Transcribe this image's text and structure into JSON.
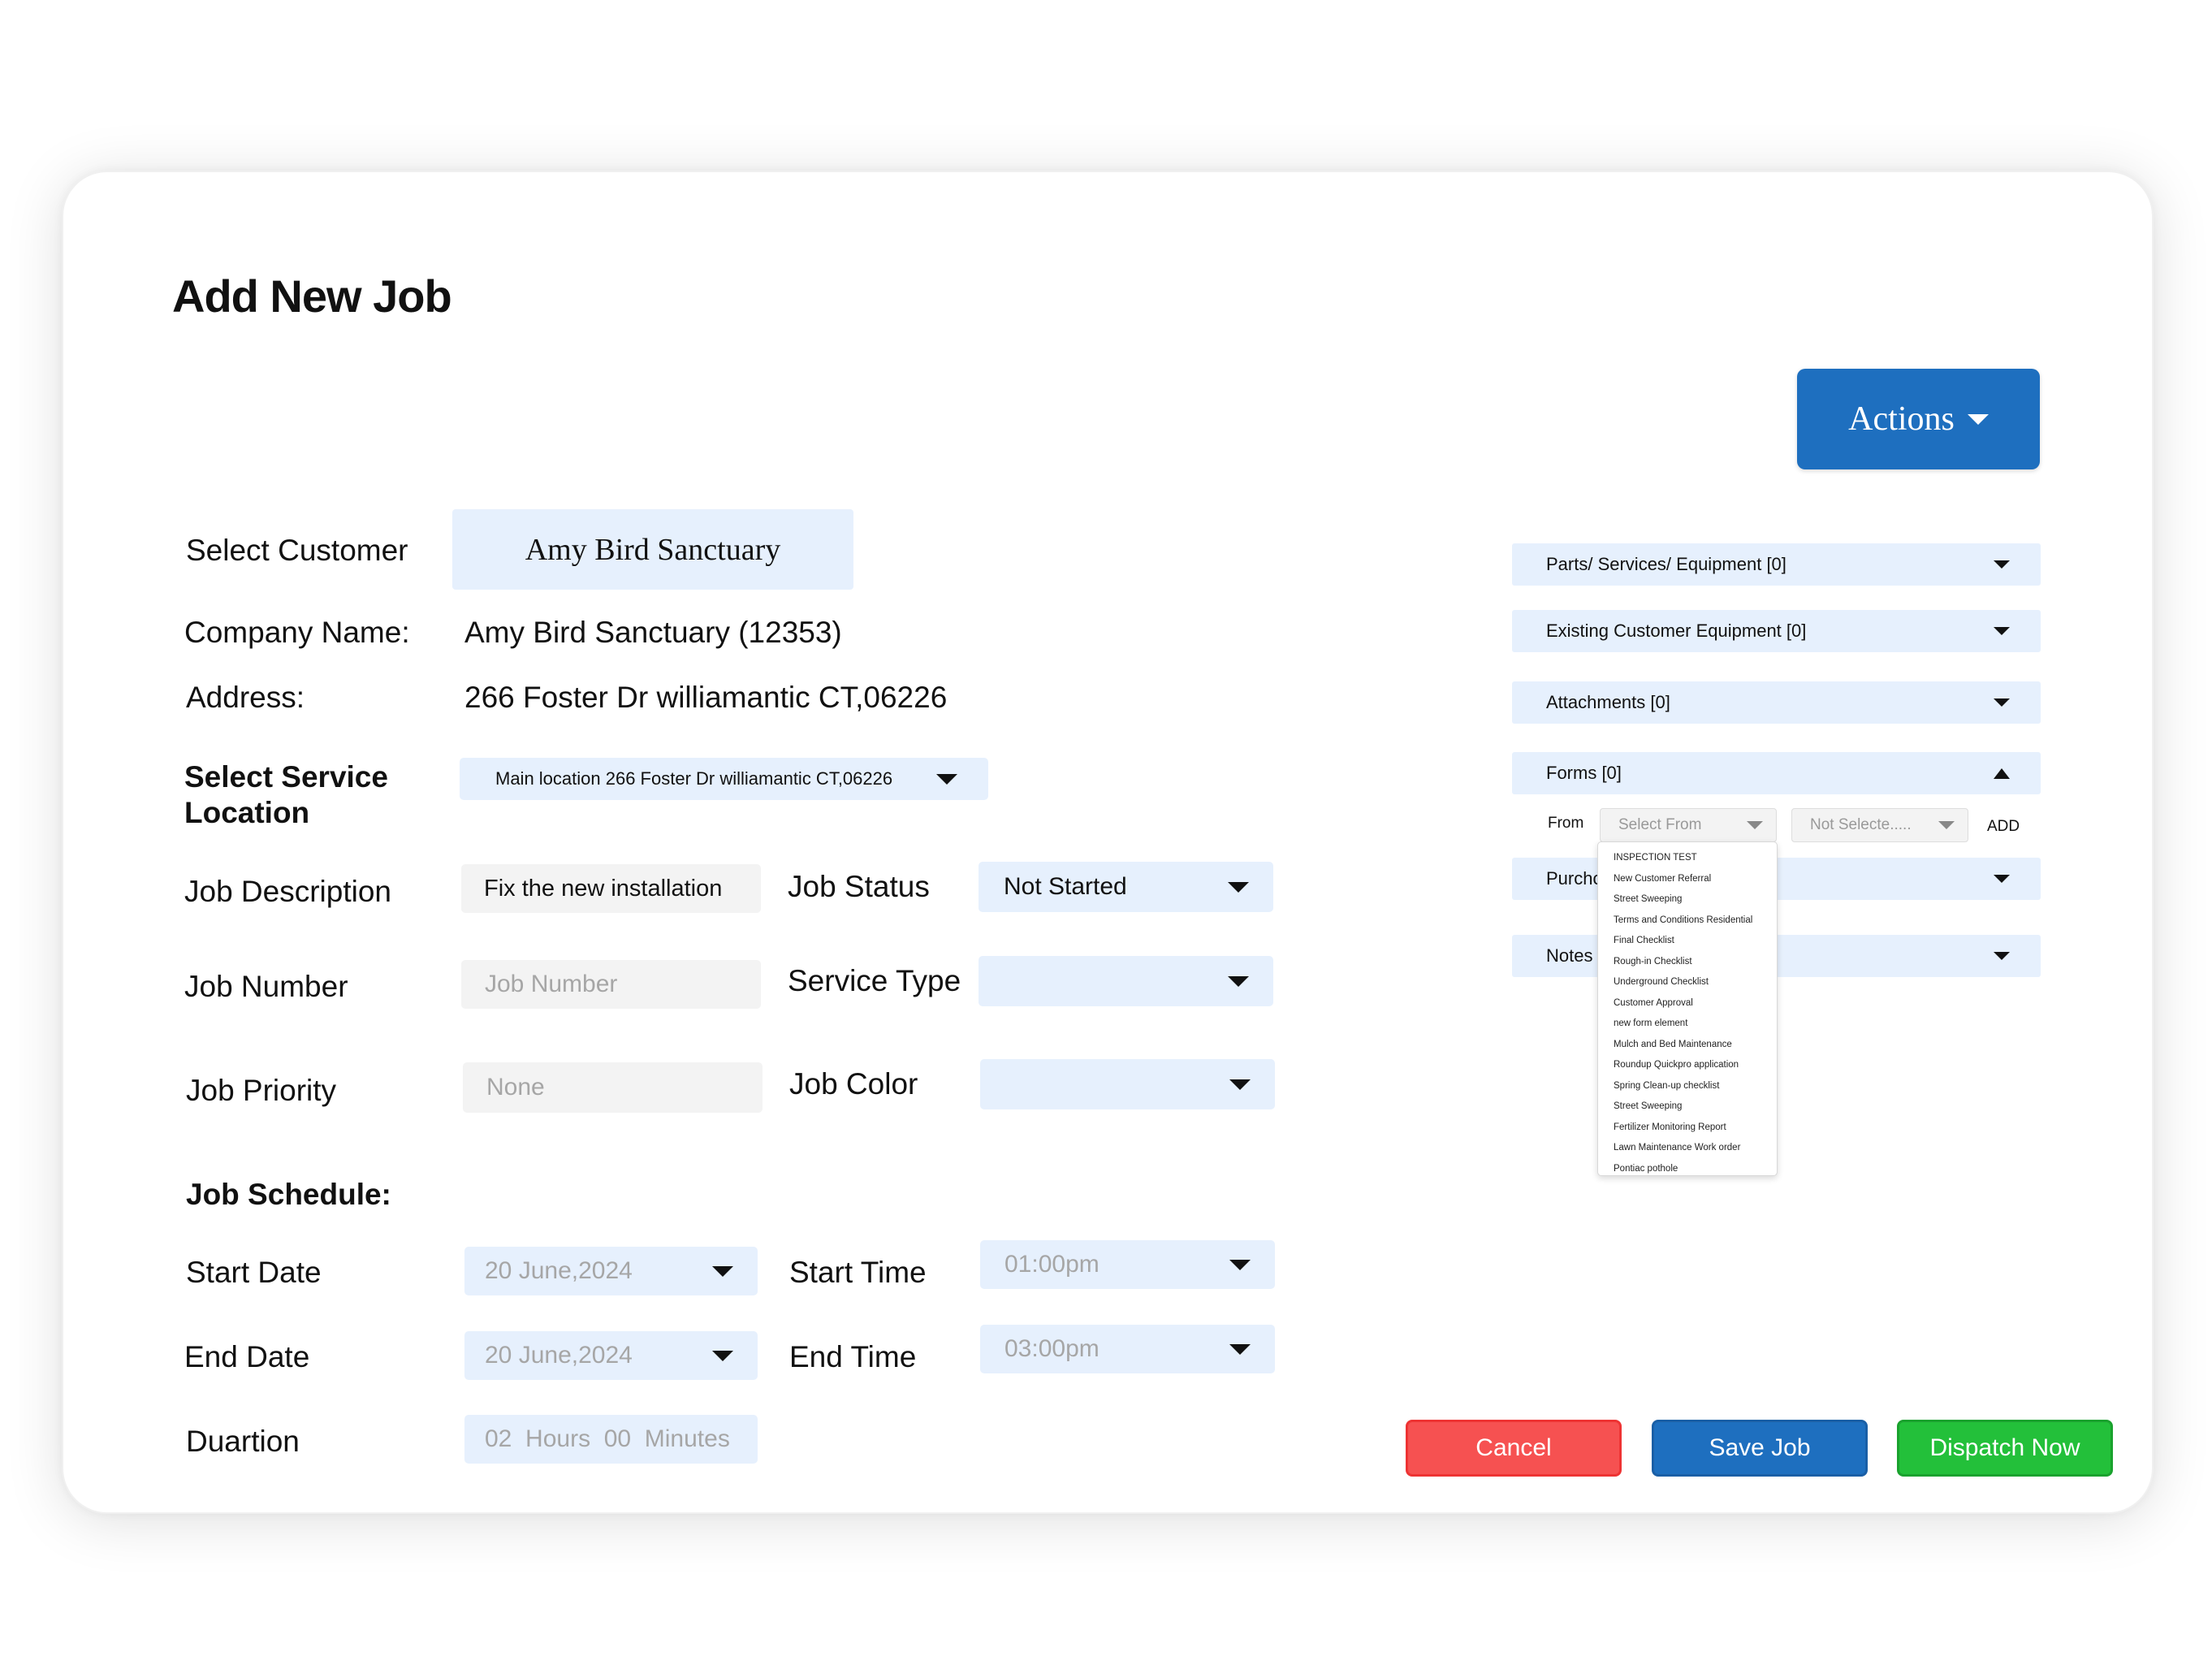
{
  "page_title": "Add New Job",
  "actions": {
    "label": "Actions"
  },
  "customer": {
    "select_label": "Select Customer",
    "selected": "Amy Bird Sanctuary",
    "company_label": "Company Name:",
    "company_value": "Amy Bird Sanctuary (12353)",
    "address_label": "Address:",
    "address_value": "266 Foster Dr williamantic CT,06226"
  },
  "service_location": {
    "label": "Select Service Location",
    "value": "Main location 266 Foster Dr williamantic CT,06226"
  },
  "job": {
    "description_label": "Job Description",
    "description_value": "Fix the new installation",
    "number_label": "Job Number",
    "number_placeholder": "Job Number",
    "priority_label": "Job Priority",
    "priority_value": "None",
    "status_label": "Job Status",
    "status_value": "Not Started",
    "service_type_label": "Service Type",
    "service_type_value": "",
    "color_label": "Job Color",
    "color_value": ""
  },
  "schedule": {
    "heading": "Job Schedule:",
    "start_date_label": "Start Date",
    "start_date_value": "20 June,2024",
    "end_date_label": "End Date",
    "end_date_value": "20 June,2024",
    "start_time_label": "Start Time",
    "start_time_value": "01:00pm",
    "end_time_label": "End Time",
    "end_time_value": "03:00pm",
    "duration_label": "Duartion",
    "duration_value": "02  Hours  00  Minutes"
  },
  "accordions": [
    {
      "label": "Parts/ Services/ Equipment [0]",
      "expanded": false
    },
    {
      "label": "Existing Customer Equipment [0]",
      "expanded": false
    },
    {
      "label": "Attachments [0]",
      "expanded": false
    },
    {
      "label": "Forms [0]",
      "expanded": true
    },
    {
      "label": "Purchc",
      "expanded": false
    },
    {
      "label": "Notes",
      "expanded": false
    }
  ],
  "forms": {
    "from_label": "From",
    "select_from_placeholder": "Select From",
    "not_selected": "Not Selecte.....",
    "add_label": "ADD",
    "options": [
      "INSPECTION TEST",
      "New Customer Referral",
      "Street Sweeping",
      "Terms and Conditions Residential",
      "Final Checklist",
      "Rough-in Checklist",
      "Underground Checklist",
      "Customer Approval",
      "new form element",
      "Mulch and Bed Maintenance",
      "Roundup Quickpro application",
      "Spring Clean-up checklist",
      "Street Sweeping",
      "Fertilizer Monitoring Report",
      "Lawn Maintenance Work order",
      "Pontiac pothole"
    ]
  },
  "buttons": {
    "cancel": "Cancel",
    "save": "Save Job",
    "dispatch": "Dispatch Now"
  },
  "colors": {
    "primary": "#1e6fbf",
    "field_bg": "#e6f0fd",
    "cancel": "#f65151",
    "dispatch": "#23c03a"
  }
}
